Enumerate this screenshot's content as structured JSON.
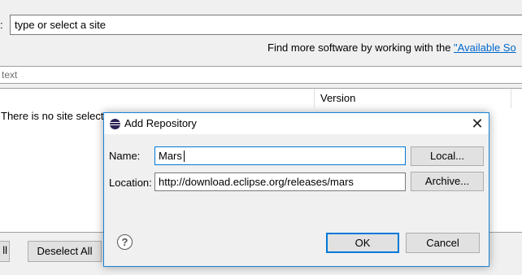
{
  "install": {
    "work_with_label": ":",
    "site_combo_value": "type or select a site",
    "find_more_prefix": "Find more software by working with the ",
    "find_more_link": "\"Available So",
    "filter_placeholder": "text",
    "table": {
      "column_version": "Version",
      "empty_message": "There is no site select"
    },
    "select_all_label": "ll",
    "deselect_all_label": "Deselect All"
  },
  "dialog": {
    "title": "Add Repository",
    "close_glyph": "✕",
    "name_label": "Name:",
    "name_value": "Mars",
    "location_label": "Location:",
    "location_value": "http://download.eclipse.org/releases/mars",
    "local_button": "Local...",
    "archive_button": "Archive...",
    "help_glyph": "?",
    "ok_button": "OK",
    "cancel_button": "Cancel"
  },
  "icons": {
    "app": "eclipse-icon",
    "help": "help-icon",
    "close": "close-icon"
  },
  "colors": {
    "link": "#0066cc",
    "focus_border": "#0078d7",
    "dialog_border": "#1883d7"
  }
}
